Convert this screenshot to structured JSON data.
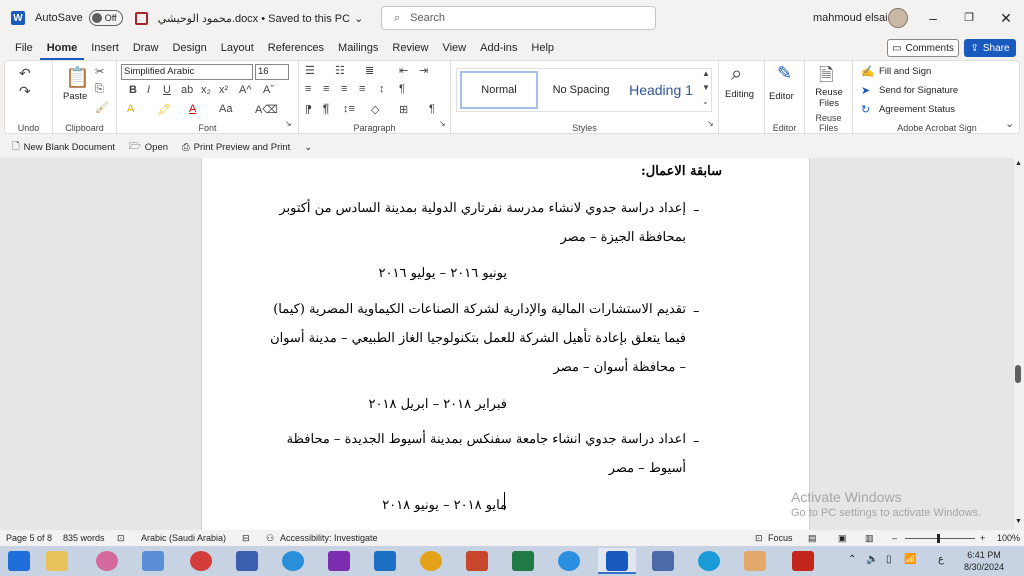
{
  "titlebar": {
    "autosave_label": "AutoSave",
    "autosave_state": "Off",
    "doc_title": "محمود الوحيشي.docx • Saved to this PC",
    "search_placeholder": "Search",
    "user_name": "mahmoud elsaid"
  },
  "menu": {
    "tabs": [
      "File",
      "Home",
      "Insert",
      "Draw",
      "Design",
      "Layout",
      "References",
      "Mailings",
      "Review",
      "View",
      "Add-ins",
      "Help"
    ],
    "active_tab": "Home",
    "comments_label": "Comments",
    "share_label": "Share"
  },
  "ribbon": {
    "undo_label": "Undo",
    "clipboard_label": "Clipboard",
    "paste_label": "Paste",
    "font_label": "Font",
    "font_name": "Simplified Arabic",
    "font_size": "16",
    "paragraph_label": "Paragraph",
    "styles_label": "Styles",
    "style_normal": "Normal",
    "style_nospacing": "No Spacing",
    "style_heading1": "Heading 1",
    "editing_label": "Editing",
    "editor_label": "Editor",
    "editor_group_label": "Editor",
    "reuse_files_label": "Reuse Files",
    "reuse_files_group_label": "Reuse Files",
    "fill_sign": "Fill and Sign",
    "send_signature": "Send for Signature",
    "agreement_status": "Agreement Status",
    "acrobat_group_label": "Adobe Acrobat Sign"
  },
  "qat": {
    "new_blank": "New Blank Document",
    "open": "Open",
    "print_preview": "Print Preview and Print"
  },
  "document": {
    "heading": "سابقة الاعمال:",
    "items": [
      {
        "lines": [
          "إعداد دراسة جدوي لانشاء مدرسة نفرتاري الدولية بمدينة السادس من أكتوبر",
          "بمحافظة الجيزة – مصر"
        ],
        "date": "يونيو ٢٠١٦ – يوليو ٢٠١٦"
      },
      {
        "lines": [
          "تقديم الاستشارات المالية والإدارية لشركة الصناعات الكيماوية المصرية (كيما)",
          "فيما يتعلق بإعادة تأهيل الشركة للعمل بتكنولوجيا الغاز الطبيعي – مدينة أسوان",
          "– محافظة أسوان – مصر"
        ],
        "date": "فبراير ٢٠١٨ – ابريل ٢٠١٨"
      },
      {
        "lines": [
          "اعداد دراسة جدوي انشاء جامعة سفنكس بمدينة أسيوط الجديدة – محافظة",
          "أسيوط – مصر"
        ],
        "date": "مايو ٢٠١٨ – يونيو ٢٠١٨"
      }
    ],
    "bullet_char": "–"
  },
  "watermark": {
    "line1": "Activate Windows",
    "line2": "Go to PC settings to activate Windows."
  },
  "status": {
    "page": "Page 5 of 8",
    "words": "835 words",
    "language": "Arabic (Saudi Arabia)",
    "accessibility": "Accessibility: Investigate",
    "focus": "Focus",
    "zoom": "100%"
  },
  "taskbar": {
    "time": "6:41 PM",
    "date": "8/30/2024",
    "lang": "ع"
  },
  "colors": {
    "word_blue": "#185abd",
    "heading_blue": "#2f5496"
  }
}
